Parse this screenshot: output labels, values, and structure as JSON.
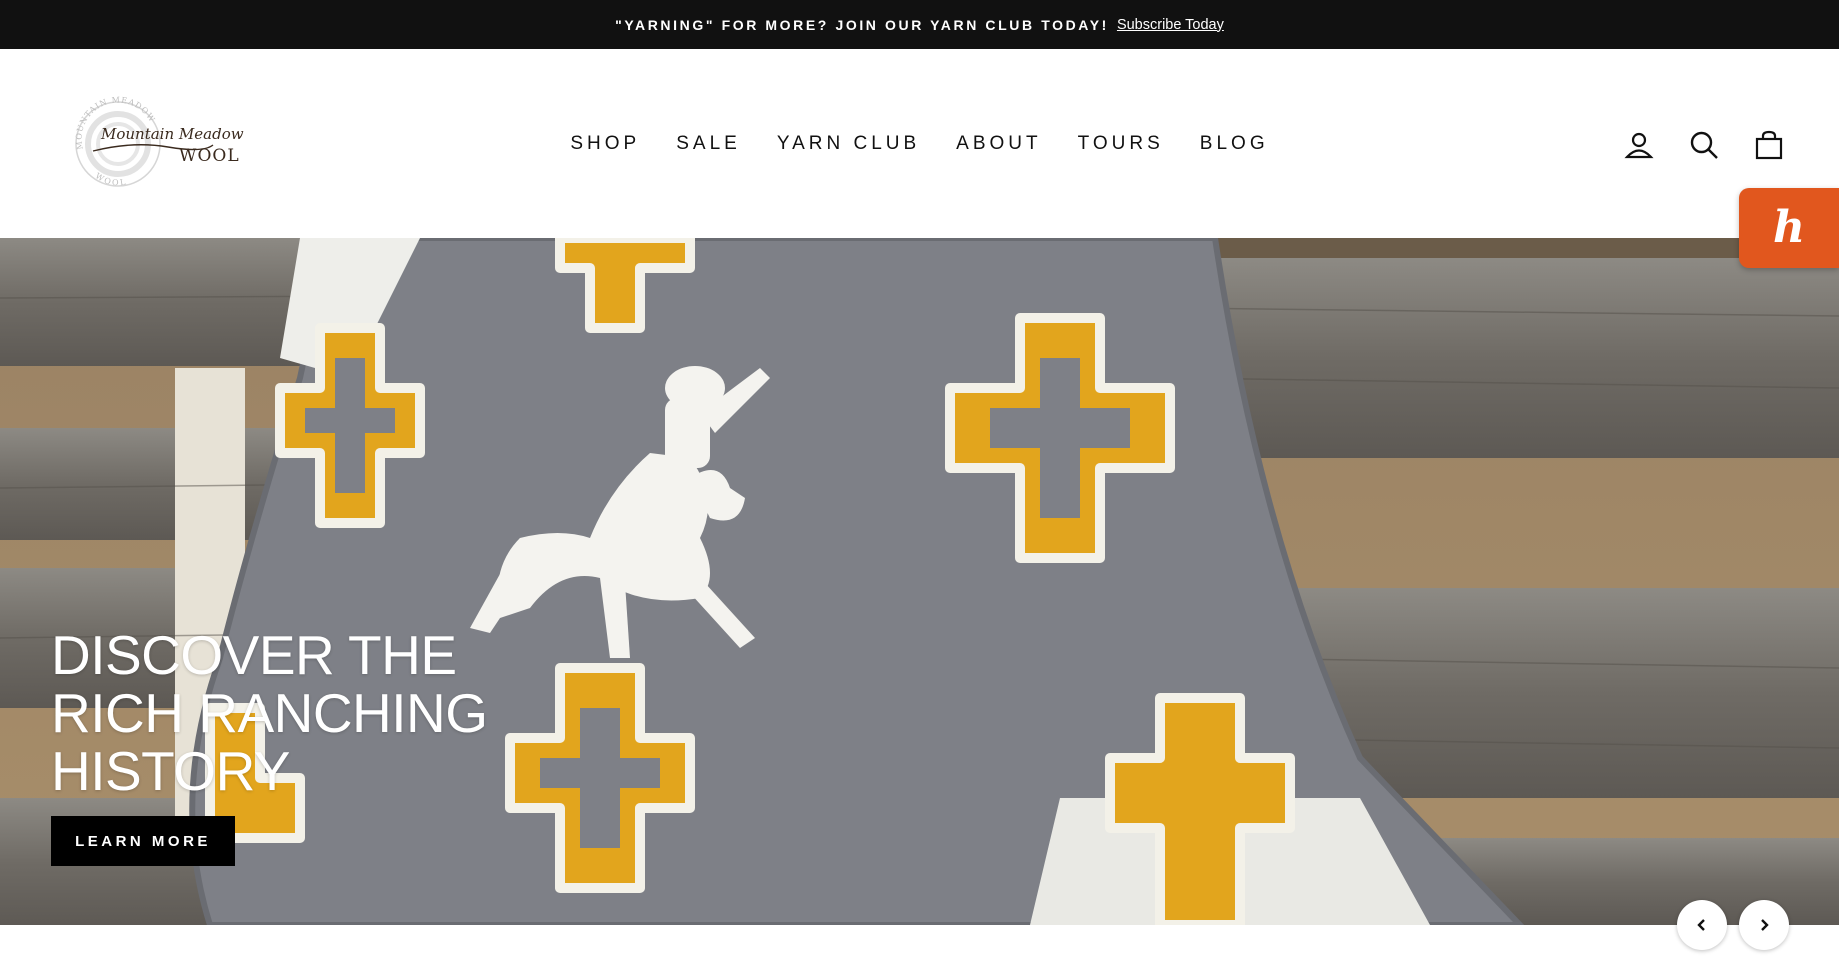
{
  "announcement": {
    "text": "\"YARNING\" FOR MORE? JOIN OUR YARN CLUB TODAY!",
    "link": "Subscribe Today"
  },
  "logo": {
    "line1": "Mountain Meadow",
    "line2": "WOOL",
    "ring_top": "MOUNTAIN MEADOW",
    "ring_bottom": "WOOL"
  },
  "nav": [
    "SHOP",
    "SALE",
    "YARN CLUB",
    "ABOUT",
    "TOURS",
    "BLOG"
  ],
  "header_icons": [
    "user-icon",
    "search-icon",
    "bag-icon"
  ],
  "widget": {
    "glyph": "h",
    "icon": "honey-icon",
    "color": "#e1571e"
  },
  "hero": {
    "lines": [
      "DISCOVER THE",
      "RICH RANCHING",
      "HISTORY"
    ],
    "button": "LEARN MORE"
  },
  "slider": {
    "prev_icon": "chevron-left-icon",
    "next_icon": "chevron-right-icon"
  }
}
